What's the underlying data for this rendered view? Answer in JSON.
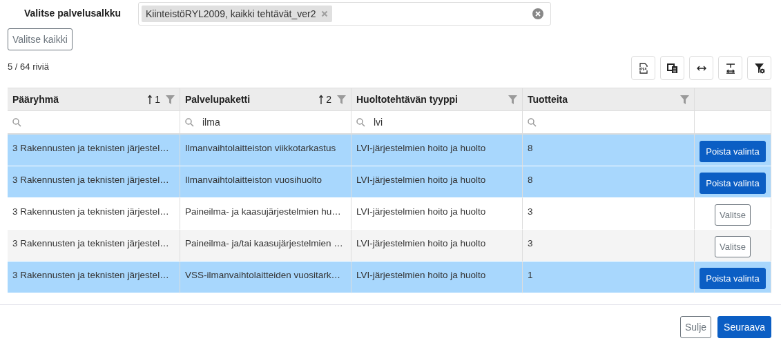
{
  "portfolio": {
    "label": "Valitse palvelusalkku",
    "chips": [
      {
        "text": "KiinteistöRYL2009, kaikki tehtävät_ver2"
      }
    ]
  },
  "select_all_button": "Valitse kaikki",
  "row_count": "5 / 64 riviä",
  "toolbar": [
    {
      "kind": "xlsx"
    },
    {
      "kind": "copy"
    },
    {
      "kind": "widen"
    },
    {
      "kind": "wrap"
    },
    {
      "kind": "clearfilter"
    }
  ],
  "table": {
    "columns": [
      {
        "title": "Pääryhmä",
        "sort": "1"
      },
      {
        "title": "Palvelupaketti",
        "sort": "2",
        "filter": "ilma"
      },
      {
        "title": "Huoltotehtävän tyyppi",
        "filter": "lvi"
      },
      {
        "title": "Tuotteita"
      },
      {
        "kind": "action"
      }
    ],
    "rows": [
      {
        "selected": true,
        "cells": [
          "3 Rakennusten ja teknisten järjestel…",
          "Ilmanvaihtolaitteiston viikkotarkastus",
          "LVI-järjestelmien hoito ja huolto",
          "8"
        ],
        "action": "Poista valinta"
      },
      {
        "selected": true,
        "cells": [
          "3 Rakennusten ja teknisten järjestel…",
          "Ilmanvaihtolaitteiston vuosihuolto",
          "LVI-järjestelmien hoito ja huolto",
          "8"
        ],
        "action": "Poista valinta"
      },
      {
        "selected": false,
        "cells": [
          "3 Rakennusten ja teknisten järjestel…",
          "Paineilma- ja kaasujärjestelmien hu…",
          "LVI-järjestelmien hoito ja huolto",
          "3"
        ],
        "action": "Valitse"
      },
      {
        "selected": false,
        "cells": [
          "3 Rakennusten ja teknisten järjestel…",
          "Paineilma- ja/tai kaasujärjestelmien …",
          "LVI-järjestelmien hoito ja huolto",
          "3"
        ],
        "action": "Valitse"
      },
      {
        "selected": true,
        "cells": [
          "3 Rakennusten ja teknisten järjestel…",
          "VSS-ilmanvaihtolaitteiden vuositark…",
          "LVI-järjestelmien hoito ja huolto",
          "1"
        ],
        "action": "Poista valinta"
      }
    ]
  },
  "footer": {
    "buttons": [
      {
        "kind": "secondary",
        "label": "Sulje"
      },
      {
        "kind": "primary",
        "label": "Seuraava"
      }
    ]
  }
}
